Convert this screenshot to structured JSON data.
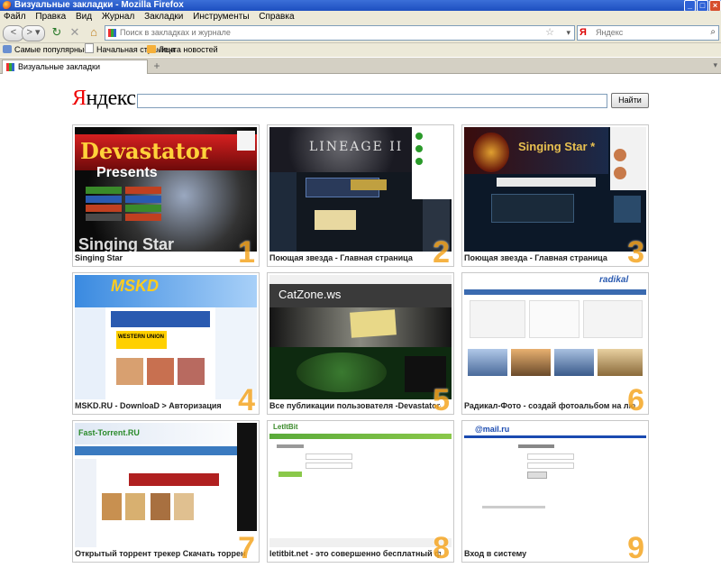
{
  "window": {
    "title": "Визуальные закладки - Mozilla Firefox"
  },
  "menu": [
    "Файл",
    "Правка",
    "Вид",
    "Журнал",
    "Закладки",
    "Инструменты",
    "Справка"
  ],
  "navbar": {
    "url_placeholder": "Поиск в закладках и журнале",
    "search_placeholder": "Яндекс",
    "search_engine": "Я"
  },
  "bookmarks_bar": [
    "Самые популярные",
    "Начальная страница",
    "Лента новостей"
  ],
  "tab": {
    "label": "Визуальные закладки",
    "new_tab": "+"
  },
  "page": {
    "logo_first": "Я",
    "logo_rest": "ндекс",
    "search_button": "Найти"
  },
  "tiles": [
    {
      "num": "1",
      "caption": "Singing Star",
      "thumb_text": "Devastator",
      "thumb_sub": "Presents"
    },
    {
      "num": "2",
      "caption": "Поющая звезда - Главная страница",
      "thumb_text": "LINEAGE II"
    },
    {
      "num": "3",
      "caption": "Поющая звезда - Главная страница",
      "thumb_text": "Singing Star *"
    },
    {
      "num": "4",
      "caption": "MSKD.RU - DownloaD > Авторизация",
      "thumb_text": "MSKD",
      "thumb_sub": "WESTERN UNION"
    },
    {
      "num": "5",
      "caption": "Все публикации пользователя -Devastator- обс",
      "thumb_text": "CatZone.ws"
    },
    {
      "num": "6",
      "caption": "Радикал-Фото - создай фотоальбом на любую",
      "thumb_text": "radikal"
    },
    {
      "num": "7",
      "caption": "Открытый торрент трекер Скачать торрент с Fast",
      "thumb_text": "Fast-Torrent.RU"
    },
    {
      "num": "8",
      "caption": "letitbit.net - это совершенно бесплатный фай",
      "thumb_text": "LetItBit"
    },
    {
      "num": "9",
      "caption": "Вход в систему",
      "thumb_text": "@mail.ru"
    }
  ]
}
